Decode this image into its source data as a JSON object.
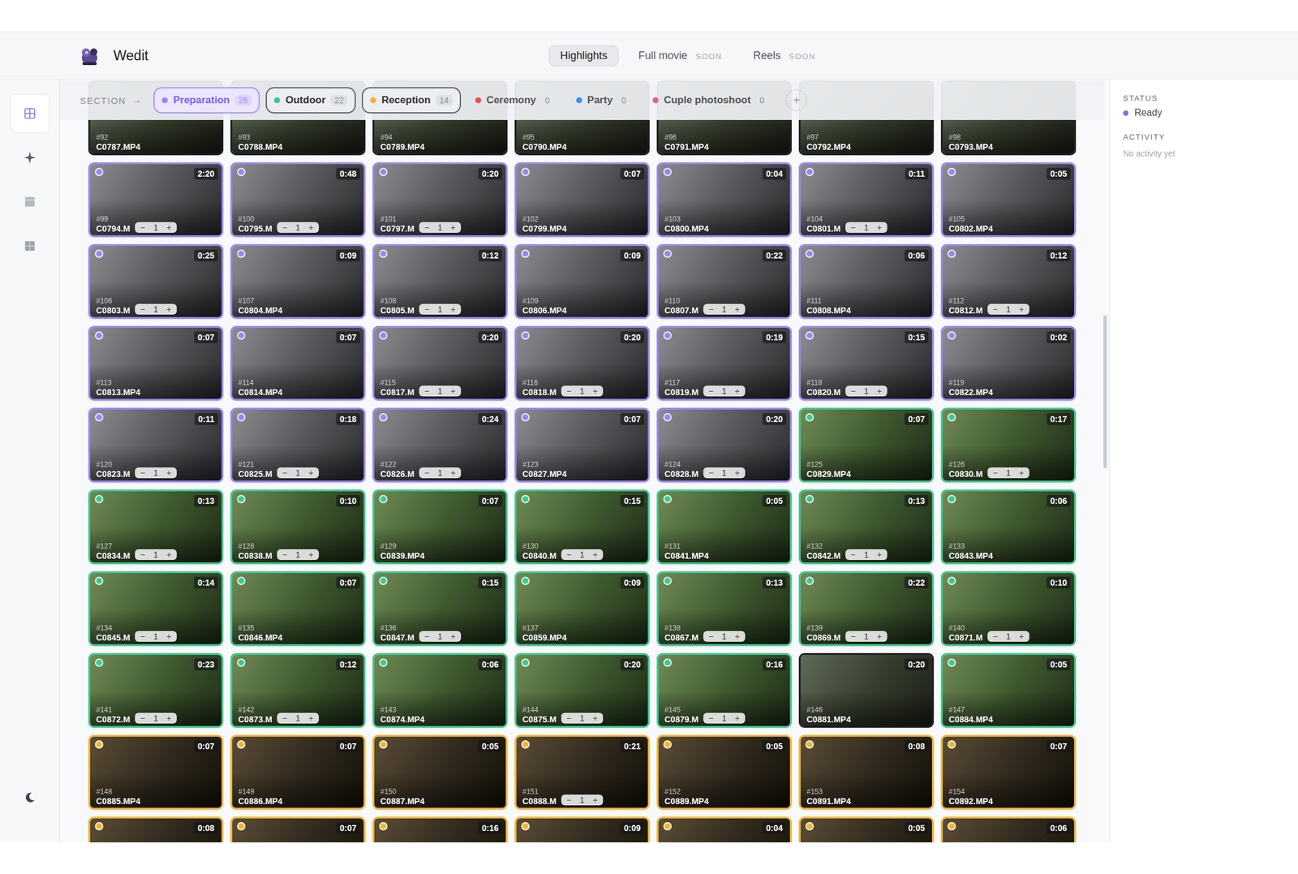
{
  "app": {
    "name": "Wedit"
  },
  "tabs": [
    {
      "label": "Highlights",
      "badge": "",
      "selected": true
    },
    {
      "label": "Full movie",
      "badge": "SOON",
      "selected": false
    },
    {
      "label": "Reels",
      "badge": "SOON",
      "selected": false
    }
  ],
  "sidebar": {
    "items": [
      {
        "kind": "grid",
        "selected": true
      },
      {
        "kind": "sparkle",
        "selected": false
      },
      {
        "kind": "panel",
        "selected": false
      },
      {
        "kind": "board",
        "selected": false
      }
    ]
  },
  "filter": {
    "label": "SECTION",
    "arrow": "→",
    "add": "+",
    "sections": [
      {
        "label": "Preparation",
        "count": "26",
        "color": "#9a86f2",
        "selected": true,
        "disabled": false
      },
      {
        "label": "Outdoor",
        "count": "22",
        "color": "#3ec98f",
        "selected": false,
        "disabled": false
      },
      {
        "label": "Reception",
        "count": "14",
        "color": "#f2b531",
        "selected": false,
        "disabled": false
      },
      {
        "label": "Ceremony",
        "count": "0",
        "color": "#e5534b",
        "selected": false,
        "disabled": true
      },
      {
        "label": "Party",
        "count": "0",
        "color": "#3d8ef0",
        "selected": false,
        "disabled": true
      },
      {
        "label": "Cuple photoshoot",
        "count": "0",
        "color": "#ec5a9b",
        "selected": false,
        "disabled": true
      }
    ]
  },
  "stepper": {
    "minus": "−",
    "plus": "+"
  },
  "clips": [
    {
      "section": null,
      "number": "#92",
      "file": "C0787.MP4",
      "duration": null,
      "count": null
    },
    {
      "section": null,
      "number": "#93",
      "file": "C0788.MP4",
      "duration": null,
      "count": null
    },
    {
      "section": null,
      "number": "#94",
      "file": "C0789.MP4",
      "duration": null,
      "count": null
    },
    {
      "section": null,
      "number": "#95",
      "file": "C0790.MP4",
      "duration": null,
      "count": null
    },
    {
      "section": null,
      "number": "#96",
      "file": "C0791.MP4",
      "duration": null,
      "count": null
    },
    {
      "section": null,
      "number": "#97",
      "file": "C0792.MP4",
      "duration": null,
      "count": null
    },
    {
      "section": null,
      "number": "#98",
      "file": "C0793.MP4",
      "duration": null,
      "count": null
    },
    {
      "section": "Preparation",
      "number": "#99",
      "file": "C0794.M",
      "duration": "2:20",
      "count": "1"
    },
    {
      "section": "Preparation",
      "number": "#100",
      "file": "C0795.M",
      "duration": "0:48",
      "count": "1"
    },
    {
      "section": "Preparation",
      "number": "#101",
      "file": "C0797.M",
      "duration": "0:20",
      "count": "1"
    },
    {
      "section": "Preparation",
      "number": "#102",
      "file": "C0799.MP4",
      "duration": "0:07",
      "count": null
    },
    {
      "section": "Preparation",
      "number": "#103",
      "file": "C0800.MP4",
      "duration": "0:04",
      "count": null
    },
    {
      "section": "Preparation",
      "number": "#104",
      "file": "C0801.M",
      "duration": "0:11",
      "count": "1"
    },
    {
      "section": "Preparation",
      "number": "#105",
      "file": "C0802.MP4",
      "duration": "0:05",
      "count": null
    },
    {
      "section": "Preparation",
      "number": "#106",
      "file": "C0803.M",
      "duration": "0:25",
      "count": "1"
    },
    {
      "section": "Preparation",
      "number": "#107",
      "file": "C0804.MP4",
      "duration": "0:09",
      "count": null
    },
    {
      "section": "Preparation",
      "number": "#108",
      "file": "C0805.M",
      "duration": "0:12",
      "count": "1"
    },
    {
      "section": "Preparation",
      "number": "#109",
      "file": "C0806.MP4",
      "duration": "0:09",
      "count": null
    },
    {
      "section": "Preparation",
      "number": "#110",
      "file": "C0807.M",
      "duration": "0:22",
      "count": "1"
    },
    {
      "section": "Preparation",
      "number": "#111",
      "file": "C0808.MP4",
      "duration": "0:06",
      "count": null
    },
    {
      "section": "Preparation",
      "number": "#112",
      "file": "C0812.M",
      "duration": "0:12",
      "count": "1"
    },
    {
      "section": "Preparation",
      "number": "#113",
      "file": "C0813.MP4",
      "duration": "0:07",
      "count": null
    },
    {
      "section": "Preparation",
      "number": "#114",
      "file": "C0814.MP4",
      "duration": "0:07",
      "count": null
    },
    {
      "section": "Preparation",
      "number": "#115",
      "file": "C0817.M",
      "duration": "0:20",
      "count": "1"
    },
    {
      "section": "Preparation",
      "number": "#116",
      "file": "C0818.M",
      "duration": "0:20",
      "count": "1"
    },
    {
      "section": "Preparation",
      "number": "#117",
      "file": "C0819.M",
      "duration": "0:19",
      "count": "1"
    },
    {
      "section": "Preparation",
      "number": "#118",
      "file": "C0820.M",
      "duration": "0:15",
      "count": "1"
    },
    {
      "section": "Preparation",
      "number": "#119",
      "file": "C0822.MP4",
      "duration": "0:02",
      "count": null
    },
    {
      "section": "Preparation",
      "number": "#120",
      "file": "C0823.M",
      "duration": "0:11",
      "count": "1"
    },
    {
      "section": "Preparation",
      "number": "#121",
      "file": "C0825.M",
      "duration": "0:18",
      "count": "1"
    },
    {
      "section": "Preparation",
      "number": "#122",
      "file": "C0826.M",
      "duration": "0:24",
      "count": "1"
    },
    {
      "section": "Preparation",
      "number": "#123",
      "file": "C0827.MP4",
      "duration": "0:07",
      "count": null
    },
    {
      "section": "Preparation",
      "number": "#124",
      "file": "C0828.M",
      "duration": "0:20",
      "count": "1"
    },
    {
      "section": "Outdoor",
      "number": "#125",
      "file": "C0829.MP4",
      "duration": "0:07",
      "count": null
    },
    {
      "section": "Outdoor",
      "number": "#126",
      "file": "C0830.M",
      "duration": "0:17",
      "count": "1"
    },
    {
      "section": "Outdoor",
      "number": "#127",
      "file": "C0834.M",
      "duration": "0:13",
      "count": "1"
    },
    {
      "section": "Outdoor",
      "number": "#128",
      "file": "C0838.M",
      "duration": "0:10",
      "count": "1"
    },
    {
      "section": "Outdoor",
      "number": "#129",
      "file": "C0839.MP4",
      "duration": "0:07",
      "count": null
    },
    {
      "section": "Outdoor",
      "number": "#130",
      "file": "C0840.M",
      "duration": "0:15",
      "count": "1"
    },
    {
      "section": "Outdoor",
      "number": "#131",
      "file": "C0841.MP4",
      "duration": "0:05",
      "count": null
    },
    {
      "section": "Outdoor",
      "number": "#132",
      "file": "C0842.M",
      "duration": "0:13",
      "count": "1"
    },
    {
      "section": "Outdoor",
      "number": "#133",
      "file": "C0843.MP4",
      "duration": "0:06",
      "count": null
    },
    {
      "section": "Outdoor",
      "number": "#134",
      "file": "C0845.M",
      "duration": "0:14",
      "count": "1"
    },
    {
      "section": "Outdoor",
      "number": "#135",
      "file": "C0846.MP4",
      "duration": "0:07",
      "count": null
    },
    {
      "section": "Outdoor",
      "number": "#136",
      "file": "C0847.M",
      "duration": "0:15",
      "count": "1"
    },
    {
      "section": "Outdoor",
      "number": "#137",
      "file": "C0859.MP4",
      "duration": "0:09",
      "count": null
    },
    {
      "section": "Outdoor",
      "number": "#138",
      "file": "C0867.M",
      "duration": "0:13",
      "count": "1"
    },
    {
      "section": "Outdoor",
      "number": "#139",
      "file": "C0869.M",
      "duration": "0:22",
      "count": "1"
    },
    {
      "section": "Outdoor",
      "number": "#140",
      "file": "C0871.M",
      "duration": "0:10",
      "count": "1"
    },
    {
      "section": "Outdoor",
      "number": "#141",
      "file": "C0872.M",
      "duration": "0:23",
      "count": "1"
    },
    {
      "section": "Outdoor",
      "number": "#142",
      "file": "C0873.M",
      "duration": "0:12",
      "count": "1"
    },
    {
      "section": "Outdoor",
      "number": "#143",
      "file": "C0874.MP4",
      "duration": "0:06",
      "count": null
    },
    {
      "section": "Outdoor",
      "number": "#144",
      "file": "C0875.M",
      "duration": "0:20",
      "count": "1"
    },
    {
      "section": "Outdoor",
      "number": "#145",
      "file": "C0879.M",
      "duration": "0:16",
      "count": "1"
    },
    {
      "section": null,
      "number": "#146",
      "file": "C0881.MP4",
      "duration": "0:20",
      "count": null
    },
    {
      "section": "Outdoor",
      "number": "#147",
      "file": "C0884.MP4",
      "duration": "0:05",
      "count": null
    },
    {
      "section": "Reception",
      "number": "#148",
      "file": "C0885.MP4",
      "duration": "0:07",
      "count": null
    },
    {
      "section": "Reception",
      "number": "#149",
      "file": "C0886.MP4",
      "duration": "0:07",
      "count": null
    },
    {
      "section": "Reception",
      "number": "#150",
      "file": "C0887.MP4",
      "duration": "0:05",
      "count": null
    },
    {
      "section": "Reception",
      "number": "#151",
      "file": "C0888.M",
      "duration": "0:21",
      "count": "1"
    },
    {
      "section": "Reception",
      "number": "#152",
      "file": "C0889.MP4",
      "duration": "0:05",
      "count": null
    },
    {
      "section": "Reception",
      "number": "#153",
      "file": "C0891.MP4",
      "duration": "0:08",
      "count": null
    },
    {
      "section": "Reception",
      "number": "#154",
      "file": "C0892.MP4",
      "duration": "0:07",
      "count": null
    },
    {
      "section": "Reception",
      "number": null,
      "file": null,
      "duration": "0:08",
      "count": null
    },
    {
      "section": "Reception",
      "number": null,
      "file": null,
      "duration": "0:07",
      "count": null
    },
    {
      "section": "Reception",
      "number": null,
      "file": null,
      "duration": "0:16",
      "count": null
    },
    {
      "section": "Reception",
      "number": null,
      "file": null,
      "duration": "0:09",
      "count": null
    },
    {
      "section": "Reception",
      "number": null,
      "file": null,
      "duration": "0:04",
      "count": null
    },
    {
      "section": "Reception",
      "number": null,
      "file": null,
      "duration": "0:05",
      "count": null
    },
    {
      "section": "Reception",
      "number": null,
      "file": null,
      "duration": "0:06",
      "count": null
    }
  ],
  "status_panel": {
    "status_label": "STATUS",
    "status": "Ready",
    "status_color": "#8b6cf0",
    "activity_label": "ACTIVITY",
    "activity": "No activity yet"
  }
}
